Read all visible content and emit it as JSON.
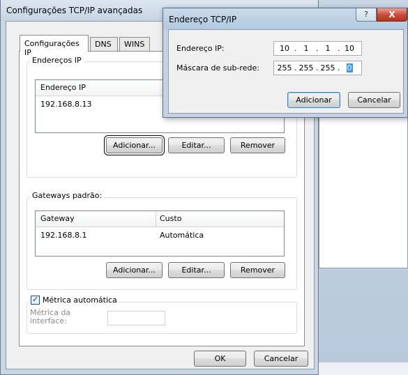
{
  "main_dialog": {
    "title": "Configurações TCP/IP avançadas",
    "tabs": [
      {
        "label": "Configurações IP"
      },
      {
        "label": "DNS"
      },
      {
        "label": "WINS"
      }
    ],
    "ip_group": {
      "label": "Endereços IP",
      "column_header": "Endereço IP",
      "rows": [
        {
          "ip": "192.168.8.13"
        }
      ],
      "buttons": {
        "add": "Adicionar...",
        "edit": "Editar...",
        "remove": "Remover"
      }
    },
    "gateway_group": {
      "label": "Gateways padrão:",
      "columns": [
        "Gateway",
        "Custo"
      ],
      "rows": [
        {
          "gateway": "192.168.8.1",
          "cost": "Automática"
        }
      ],
      "buttons": {
        "add": "Adicionar...",
        "edit": "Editar...",
        "remove": "Remover"
      }
    },
    "metric": {
      "checkbox_label": "Métrica automática",
      "checked": true,
      "interface_label_line1": "Métrica da",
      "interface_label_line2": "interface:",
      "interface_value": ""
    },
    "footer": {
      "ok": "OK",
      "cancel": "Cancelar"
    }
  },
  "address_dialog": {
    "title": "Endereço TCP/IP",
    "help_glyph": "?",
    "close_glyph": "X",
    "ip_label": "Endereço IP:",
    "ip_octets": [
      "10",
      "1",
      "1",
      "10"
    ],
    "mask_label": "Máscara de sub-rede:",
    "mask_octets": [
      "255",
      "255",
      "255",
      "0"
    ],
    "add_button": "Adicionar",
    "cancel_button": "Cancelar"
  },
  "colors": {
    "title_bar": "#c6d4e2",
    "close_button": "#c9503c",
    "selection": "#3399ff"
  }
}
